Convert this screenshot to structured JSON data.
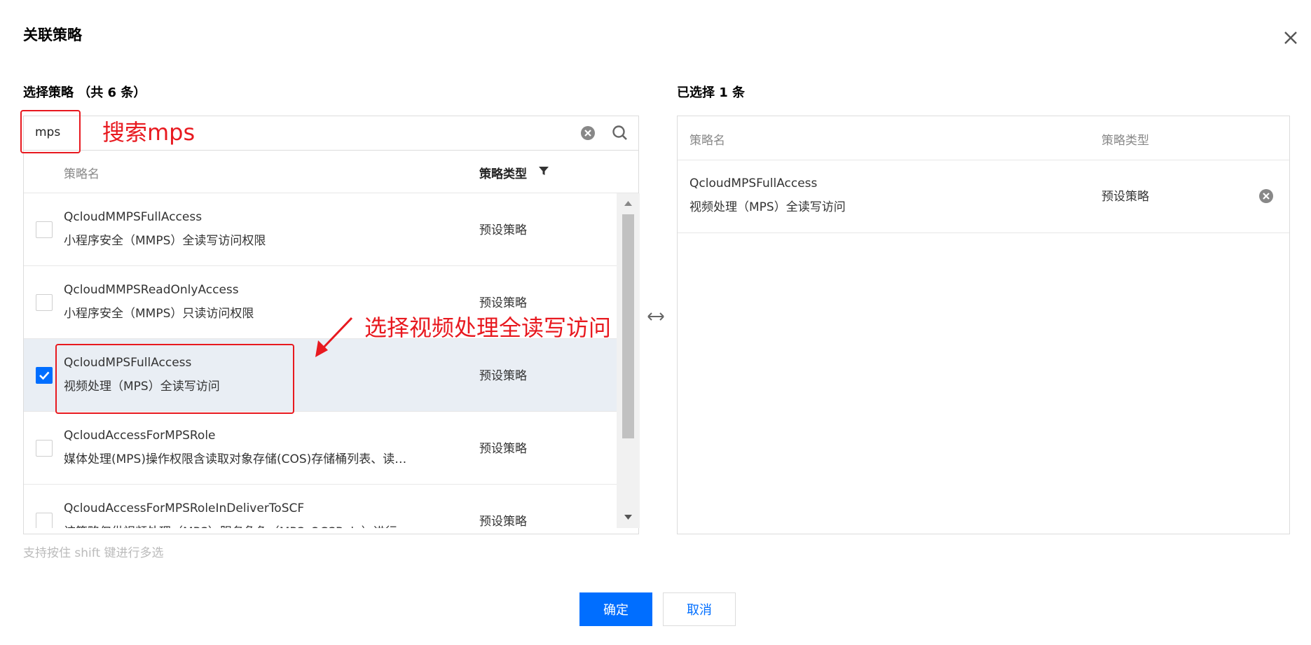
{
  "dialog": {
    "title": "关联策略"
  },
  "left": {
    "label": "选择策略 （共 6 条）",
    "search_value": "mps",
    "columns": {
      "name": "策略名",
      "type": "策略类型"
    },
    "rows": [
      {
        "name": "QcloudMMPSFullAccess",
        "desc": "小程序安全（MMPS）全读写访问权限",
        "type": "预设策略",
        "checked": false
      },
      {
        "name": "QcloudMMPSReadOnlyAccess",
        "desc": "小程序安全（MMPS）只读访问权限",
        "type": "预设策略",
        "checked": false
      },
      {
        "name": "QcloudMPSFullAccess",
        "desc": "视频处理（MPS）全读写访问",
        "type": "预设策略",
        "checked": true
      },
      {
        "name": "QcloudAccessForMPSRole",
        "desc": "媒体处理(MPS)操作权限含读取对象存储(COS)存储桶列表、读…",
        "type": "预设策略",
        "checked": false
      },
      {
        "name": "QcloudAccessForMPSRoleInDeliverToSCF",
        "desc": "该策略仅供视频处理（MPS）服务角色（MPS_QCSRole）进行…",
        "type": "预设策略",
        "checked": false
      }
    ]
  },
  "hint": "支持按住 shift 键进行多选",
  "right": {
    "label": "已选择 1 条",
    "columns": {
      "name": "策略名",
      "type": "策略类型"
    },
    "rows": [
      {
        "name": "QcloudMPSFullAccess",
        "desc": "视频处理（MPS）全读写访问",
        "type": "预设策略"
      }
    ]
  },
  "buttons": {
    "confirm": "确定",
    "cancel": "取消"
  },
  "annotations": {
    "search": "搜索mps",
    "select": "选择视频处理全读写访问"
  },
  "colors": {
    "primary": "#006eff",
    "annotation": "#e8191f",
    "selected_row": "#e9eef4"
  },
  "icons": [
    "close-icon",
    "clear-icon",
    "search-icon",
    "filter-icon",
    "check-icon",
    "swap-icon",
    "remove-icon"
  ]
}
